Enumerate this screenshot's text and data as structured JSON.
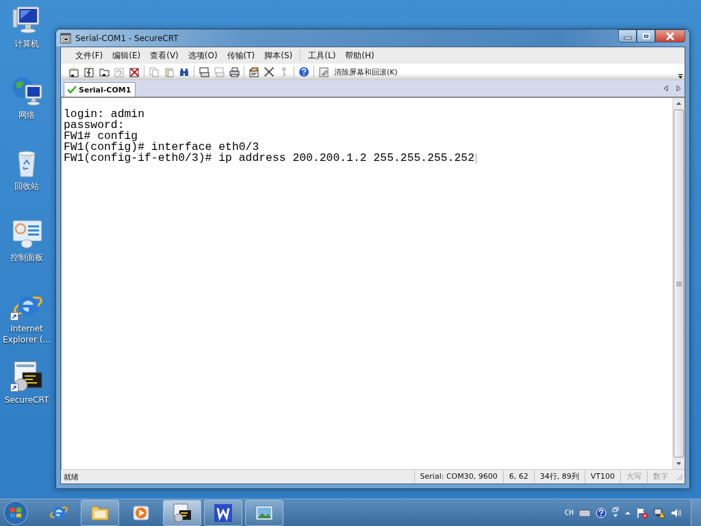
{
  "desktop_icons": [
    {
      "label": "计算机",
      "shortcut": false
    },
    {
      "label": "网络",
      "shortcut": false
    },
    {
      "label": "回收站",
      "shortcut": false
    },
    {
      "label": "控制面板",
      "shortcut": false
    },
    {
      "label": "Internet Explorer (...",
      "shortcut": true
    },
    {
      "label": "SecureCRT",
      "shortcut": true
    }
  ],
  "window": {
    "title": "Serial-COM1 - SecureCRT"
  },
  "menu": [
    "文件(F)",
    "编辑(E)",
    "查看(V)",
    "选项(O)",
    "传输(T)",
    "脚本(S)",
    "工具(L)",
    "帮助(H)"
  ],
  "toolbar": [
    {
      "kind": "icon",
      "disabled": false
    },
    {
      "kind": "icon",
      "disabled": false
    },
    {
      "kind": "icon",
      "disabled": false
    },
    {
      "kind": "icon",
      "disabled": true
    },
    {
      "kind": "icon",
      "disabled": false
    },
    {
      "kind": "separator"
    },
    {
      "kind": "icon",
      "disabled": true
    },
    {
      "kind": "icon",
      "disabled": true
    },
    {
      "kind": "icon",
      "disabled": false
    },
    {
      "kind": "separator"
    },
    {
      "kind": "icon",
      "disabled": false
    },
    {
      "kind": "icon",
      "disabled": true
    },
    {
      "kind": "icon",
      "disabled": false
    },
    {
      "kind": "separator"
    },
    {
      "kind": "icon",
      "disabled": false
    },
    {
      "kind": "icon",
      "disabled": false
    },
    {
      "kind": "icon",
      "disabled": true
    },
    {
      "kind": "separator"
    },
    {
      "kind": "icon",
      "disabled": false
    },
    {
      "kind": "separator"
    },
    {
      "kind": "text",
      "label": "清除屏幕和回滚(K)",
      "disabled": false
    }
  ],
  "tabs": [
    {
      "label": "Serial-COM1",
      "selected": true,
      "connected": true
    }
  ],
  "terminal": {
    "lines": [
      "login: admin",
      "password:",
      "FW1# config",
      "FW1(config)# interface eth0/3",
      "FW1(config-if-eth0/3)# ip address 200.200.1.2 255.255.255.252"
    ]
  },
  "status_bar": {
    "message": "就绪",
    "fields": [
      {
        "text": "Serial: COM30, 9600",
        "disabled": false
      },
      {
        "text": "6,  62",
        "disabled": false
      },
      {
        "text": "34行, 89列",
        "disabled": false
      },
      {
        "text": "VT100",
        "disabled": false
      },
      {
        "text": "大写",
        "disabled": true
      },
      {
        "text": "数字",
        "disabled": true
      }
    ]
  },
  "taskbar": {
    "items": [
      {
        "running": false,
        "selected": false
      },
      {
        "running": true,
        "selected": false
      },
      {
        "running": false,
        "selected": false
      },
      {
        "running": true,
        "selected": true
      },
      {
        "running": true,
        "selected": false
      },
      {
        "running": true,
        "selected": false
      }
    ],
    "tray": {
      "language": "CH"
    }
  }
}
